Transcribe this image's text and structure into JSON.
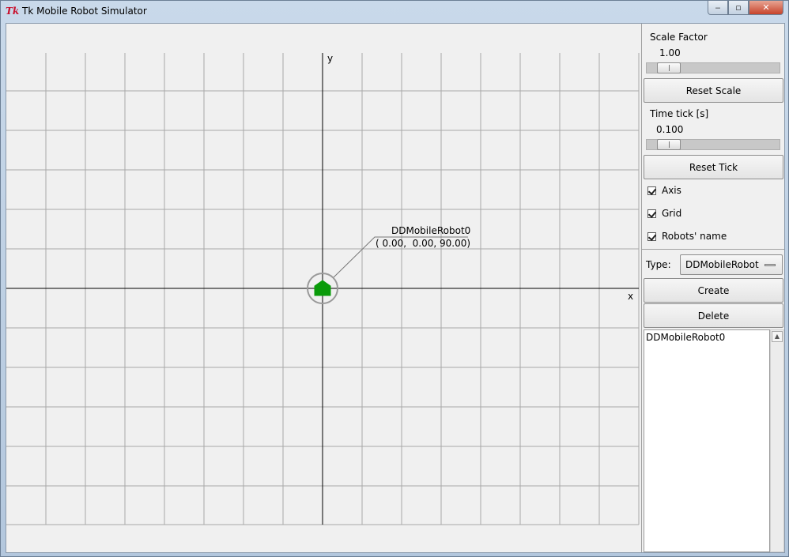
{
  "window": {
    "icon": "tk-feather-icon",
    "icon_text": "Tk",
    "title": "Tk Mobile Robot Simulator",
    "minimize": "‒",
    "maximize": "▫",
    "close": "✕"
  },
  "canvas": {
    "x_axis_label": "x",
    "y_axis_label": "y",
    "robot": {
      "name": "DDMobileRobot0",
      "pose_text": "( 0.00,  0.00, 90.00)",
      "body_color": "#0a9b0a"
    }
  },
  "panel": {
    "scale_label": "Scale Factor",
    "scale_value": "1.00",
    "reset_scale": "Reset Scale",
    "tick_label": "Time tick [s]",
    "tick_value": "0.100",
    "reset_tick": "Reset Tick",
    "checks": [
      {
        "label": "Axis",
        "checked": true
      },
      {
        "label": "Grid",
        "checked": true
      },
      {
        "label": "Robots' name",
        "checked": true
      }
    ],
    "type_label": "Type:",
    "type_value": "DDMobileRobot",
    "create": "Create",
    "delete": "Delete",
    "robot_list": [
      "DDMobileRobot0"
    ]
  }
}
